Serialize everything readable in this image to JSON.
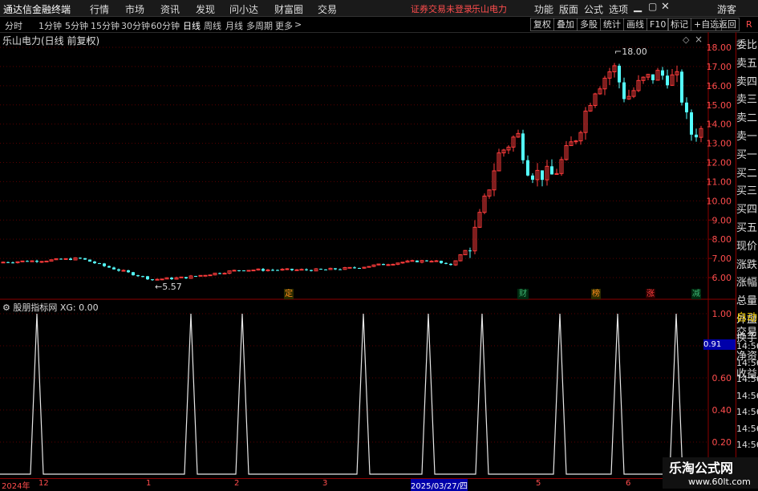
{
  "menubar": {
    "app_title": "通达信金融终端",
    "items": [
      "行情",
      "市场",
      "资讯",
      "发现",
      "问小达",
      "财富圈",
      "交易"
    ],
    "notice": "证券交易未登录",
    "stock_name": "乐山电力",
    "right_items": [
      "功能",
      "版面",
      "公式",
      "选项"
    ],
    "guest": "游客",
    "window_controls": [
      "minimize-icon",
      "restore-icon",
      "close-icon"
    ]
  },
  "toolbar": {
    "periods": [
      "分时",
      "1分钟",
      "5分钟",
      "15分钟",
      "30分钟",
      "60分钟",
      "日线",
      "周线",
      "月线",
      "多周期",
      "更多"
    ],
    "active_period": "日线",
    "right_buttons": [
      "复权",
      "叠加",
      "多股",
      "统计",
      "画线",
      "F10",
      "标记",
      "+自选",
      "返回"
    ],
    "r_label": "R"
  },
  "main_chart": {
    "title": "乐山电力(日线 前复权)",
    "price_axis": [
      "18.00",
      "17.00",
      "16.00",
      "15.00",
      "14.00",
      "13.00",
      "12.00",
      "11.00",
      "10.00",
      "9.00",
      "8.00",
      "7.00",
      "6.00"
    ],
    "max_label": "18.00",
    "min_label": "5.57",
    "event_markers": [
      {
        "label": "定",
        "color": "#ff8c1a"
      },
      {
        "label": "财",
        "color": "#3cb371"
      },
      {
        "label": "榜",
        "color": "#ff8c1a"
      },
      {
        "label": "涨",
        "color": "#ff4040"
      },
      {
        "label": "减",
        "color": "#3cb371"
      }
    ]
  },
  "indicator": {
    "title": "股朋指标网 XG: 0.00",
    "axis": [
      "1.00",
      "0.80",
      "0.60",
      "0.40",
      "0.20"
    ],
    "current_value": "0.91"
  },
  "right_panel": {
    "labels": [
      "委比",
      "卖五",
      "卖四",
      "卖三",
      "卖二",
      "卖一",
      "买一",
      "买二",
      "买三",
      "买四",
      "买五",
      "现价",
      "涨跌",
      "涨幅",
      "总量",
      "外盘",
      "换手",
      "净资",
      "收益"
    ],
    "auto_label": "自动",
    "trade_label": "交易",
    "times": [
      "14:56",
      "14:56",
      "14:56",
      "14:56",
      "14:56",
      "14:56",
      "14:56",
      "14:5"
    ]
  },
  "date_axis": {
    "labels": [
      "2024年",
      "12",
      "1",
      "2",
      "3",
      "2025/03/27/四",
      "5",
      "6"
    ]
  },
  "watermark": {
    "title": "乐淘公式网",
    "url": "www.60lt.com"
  },
  "colors": {
    "up": "#ff3b3b",
    "down": "#54ffff",
    "grid": "#8b0000",
    "axis_text": "#ff4d4d"
  }
}
